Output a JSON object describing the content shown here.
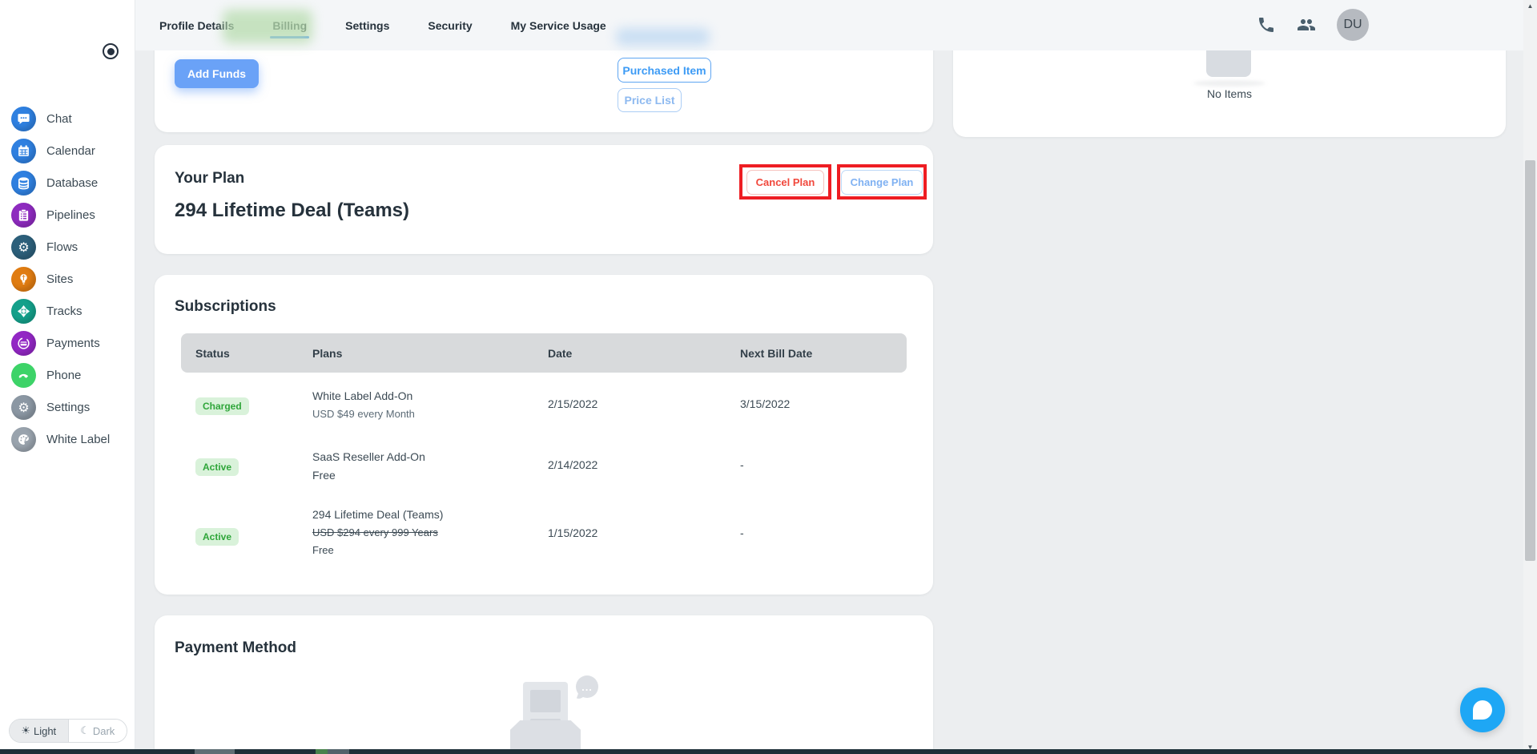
{
  "header": {
    "tabs": [
      {
        "label": "Profile Details",
        "active": false
      },
      {
        "label": "Billing",
        "active": true
      },
      {
        "label": "Settings",
        "active": false
      },
      {
        "label": "Security",
        "active": false
      },
      {
        "label": "My Service Usage",
        "active": false
      }
    ],
    "avatar_initials": "DU"
  },
  "sidebar": {
    "items": [
      {
        "label": "Chat",
        "color": "#2f80e0"
      },
      {
        "label": "Calendar",
        "color": "#2f80e0"
      },
      {
        "label": "Database",
        "color": "#2f80e0"
      },
      {
        "label": "Pipelines",
        "color": "#8e2bbf"
      },
      {
        "label": "Flows",
        "color": "#2c5f7a"
      },
      {
        "label": "Sites",
        "color": "#e07c12"
      },
      {
        "label": "Tracks",
        "color": "#14a08a"
      },
      {
        "label": "Payments",
        "color": "#9227c4"
      },
      {
        "label": "Phone",
        "color": "#3dd368"
      },
      {
        "label": "Settings",
        "color": "#8b97a3"
      },
      {
        "label": "White Label",
        "color": "#99a3ad"
      }
    ],
    "theme_toggle": {
      "light": "Light",
      "dark": "Dark"
    }
  },
  "wallet_card": {
    "add_funds": "Add Funds",
    "purchased_item": "Purchased Item",
    "price_list": "Price List"
  },
  "plan_card": {
    "title": "Your Plan",
    "plan_name": "294 Lifetime Deal (Teams)",
    "cancel_label": "Cancel Plan",
    "change_label": "Change Plan"
  },
  "subscriptions": {
    "title": "Subscriptions",
    "columns": [
      "Status",
      "Plans",
      "Date",
      "Next Bill Date"
    ],
    "rows": [
      {
        "status": "Charged",
        "plan": "White Label Add-On",
        "price": "USD $49 every Month",
        "price2": "",
        "date": "2/15/2022",
        "next_bill": "3/15/2022"
      },
      {
        "status": "Active",
        "plan": "SaaS Reseller Add-On",
        "price": "Free",
        "price2": "",
        "date": "2/14/2022",
        "next_bill": "-"
      },
      {
        "status": "Active",
        "plan": "294 Lifetime Deal (Teams)",
        "price": "USD $294 every 999 Years",
        "price2": "Free",
        "date": "1/15/2022",
        "next_bill": "-"
      }
    ]
  },
  "payment_card": {
    "title": "Payment Method",
    "bubble_dots": "..."
  },
  "right_panel": {
    "empty_text": "No Items"
  },
  "glyphs": {
    "sun": "☀",
    "moon": "☾",
    "gear": "⚙",
    "phone_handset": "☎",
    "arrow_up": "▲",
    "arrow_down": "▼"
  },
  "colors": {
    "accent_blue": "#64a5f6",
    "primary_button": "#6aa2f7",
    "badge_bg": "#d9f2da",
    "badge_text": "#2fa63a",
    "annotation_red": "#ee1d23",
    "launcher_blue": "#1ea7f5",
    "header_bg": "#f4f6f8",
    "page_bg": "#eceef0"
  }
}
